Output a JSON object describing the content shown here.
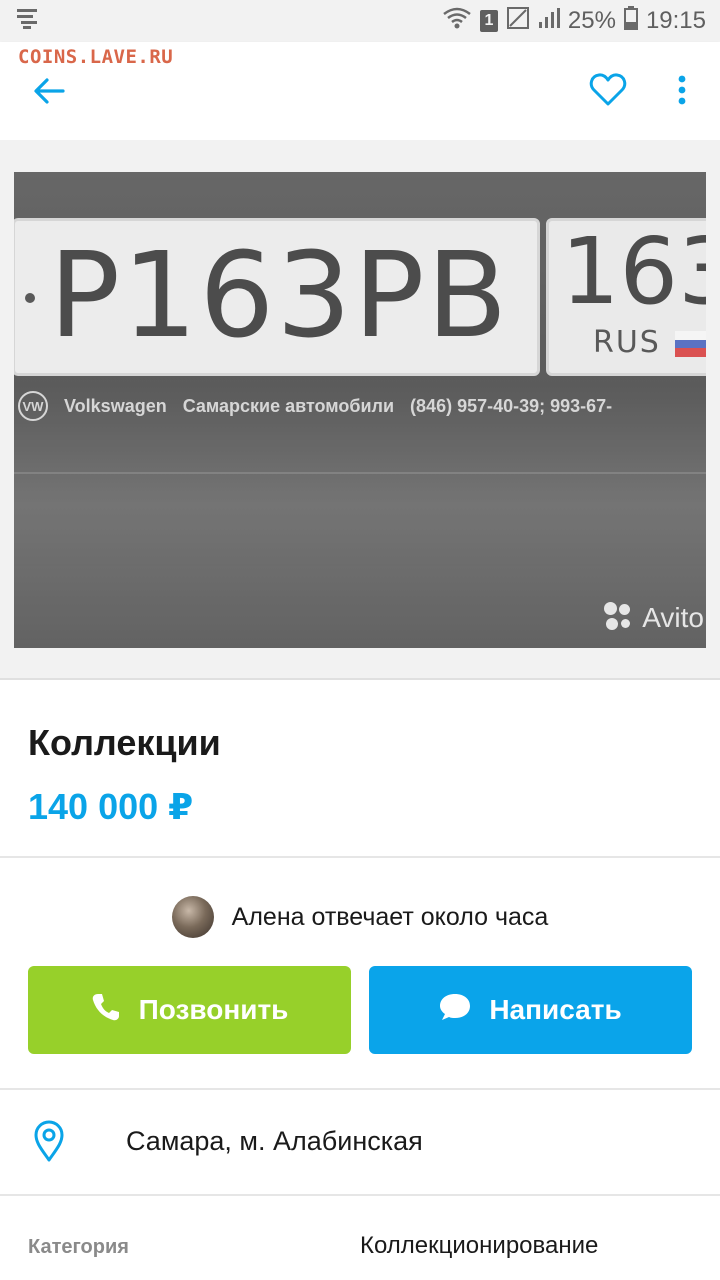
{
  "status_bar": {
    "battery": "25%",
    "time": "19:15",
    "sim_badge": "1"
  },
  "watermark": "COINS.LAVE.RU",
  "photo": {
    "plate_number": "P163PB",
    "region_code": "163",
    "country": "RUS",
    "dealer_brand": "Volkswagen",
    "dealer_name": "Самарские автомобили",
    "dealer_phone": "(846) 957-40-39; 993-67-",
    "vw_mark": "VW",
    "avito_mark": "Avito"
  },
  "listing": {
    "title": "Коллекции",
    "price": "140 000 ₽"
  },
  "seller": {
    "response_text": "Алена отвечает около часа"
  },
  "actions": {
    "call_label": "Позвонить",
    "write_label": "Написать"
  },
  "location": {
    "text": "Самара, м. Алабинская"
  },
  "details": {
    "category_label": "Категория",
    "category_value": "Коллекционирование"
  },
  "colors": {
    "accent_blue": "#0aa4e8",
    "call_green": "#97d02a",
    "watermark_orange": "#d9674a"
  },
  "icons": {
    "back": "arrow-left-icon",
    "favorite": "heart-icon",
    "more": "more-vertical-icon",
    "phone": "phone-icon",
    "chat": "chat-bubble-icon",
    "location": "location-pin-icon"
  }
}
